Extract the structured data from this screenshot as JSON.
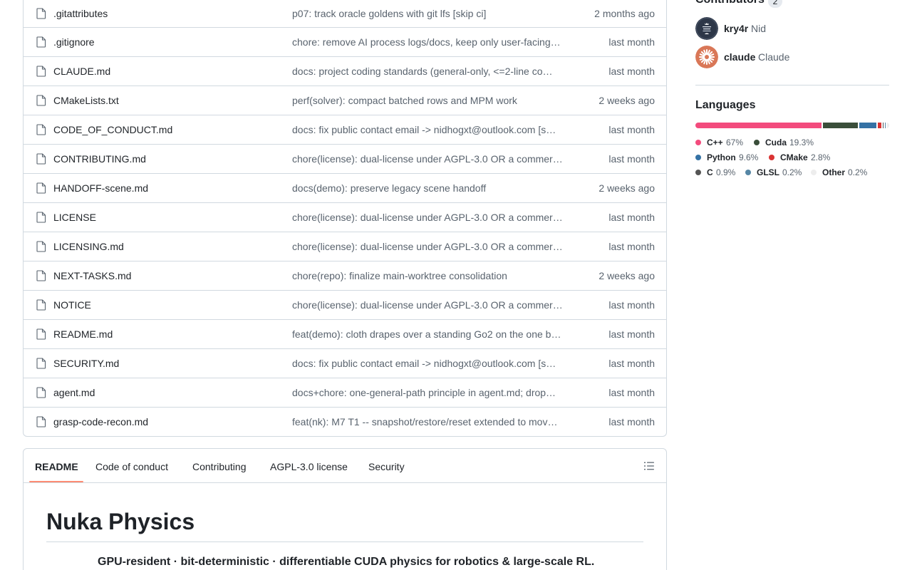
{
  "files": [
    {
      "name": ".gitattributes",
      "commit": "p07: track oracle goldens with git lfs [skip ci]",
      "date": "2 months ago"
    },
    {
      "name": ".gitignore",
      "commit": "chore: remove AI process logs/docs, keep only user-facing…",
      "date": "last month"
    },
    {
      "name": "CLAUDE.md",
      "commit": "docs: project coding standards (general-only, <=2-line co…",
      "date": "last month"
    },
    {
      "name": "CMakeLists.txt",
      "commit": "perf(solver): compact batched rows and MPM work",
      "date": "2 weeks ago"
    },
    {
      "name": "CODE_OF_CONDUCT.md",
      "commit": "docs: fix public contact email -> nidhogxt@outlook.com [s…",
      "date": "last month"
    },
    {
      "name": "CONTRIBUTING.md",
      "commit": "chore(license): dual-license under AGPL-3.0 OR a commer…",
      "date": "last month"
    },
    {
      "name": "HANDOFF-scene.md",
      "commit": "docs(demo): preserve legacy scene handoff",
      "date": "2 weeks ago"
    },
    {
      "name": "LICENSE",
      "commit": "chore(license): dual-license under AGPL-3.0 OR a commer…",
      "date": "last month"
    },
    {
      "name": "LICENSING.md",
      "commit": "chore(license): dual-license under AGPL-3.0 OR a commer…",
      "date": "last month"
    },
    {
      "name": "NEXT-TASKS.md",
      "commit": "chore(repo): finalize main-worktree consolidation",
      "date": "2 weeks ago"
    },
    {
      "name": "NOTICE",
      "commit": "chore(license): dual-license under AGPL-3.0 OR a commer…",
      "date": "last month"
    },
    {
      "name": "README.md",
      "commit": "feat(demo): cloth drapes over a standing Go2 on the one b…",
      "date": "last month"
    },
    {
      "name": "SECURITY.md",
      "commit": "docs: fix public contact email -> nidhogxt@outlook.com [s…",
      "date": "last month"
    },
    {
      "name": "agent.md",
      "commit": "docs+chore: one-general-path principle in agent.md; drop…",
      "date": "last month"
    },
    {
      "name": "grasp-code-recon.md",
      "commit": "feat(nk): M7 T1 -- snapshot/restore/reset extended to mov…",
      "date": "last month"
    }
  ],
  "readme": {
    "tabs": [
      "README",
      "Code of conduct",
      "Contributing",
      "AGPL-3.0 license",
      "Security"
    ],
    "active_tab": "README",
    "outline_icon": "list-unordered-icon",
    "title": "Nuka Physics",
    "tagline": "GPU-resident · bit-deterministic · differentiable CUDA physics for robotics & large-scale RL."
  },
  "sidebar": {
    "contributors_heading": "Contributors",
    "contributors_count": "2",
    "contributors": [
      {
        "login": "kry4r",
        "name": "Nid",
        "avatar_icon": "keep-calm-avatar-icon",
        "avatar_color": "#2d3748"
      },
      {
        "login": "claude",
        "name": "Claude",
        "avatar_icon": "claude-sunburst-avatar-icon",
        "avatar_color": "#d97757"
      }
    ],
    "languages_heading": "Languages",
    "languages": [
      {
        "name": "C++",
        "percent": "67%",
        "value": 67,
        "color": "#f34b7d"
      },
      {
        "name": "Cuda",
        "percent": "19.3%",
        "value": 19.3,
        "color": "#3a4e3a"
      },
      {
        "name": "Python",
        "percent": "9.6%",
        "value": 9.6,
        "color": "#3572a5"
      },
      {
        "name": "CMake",
        "percent": "2.8%",
        "value": 2.8,
        "color": "#da3434"
      },
      {
        "name": "C",
        "percent": "0.9%",
        "value": 0.9,
        "color": "#555555"
      },
      {
        "name": "GLSL",
        "percent": "0.2%",
        "value": 0.2,
        "color": "#5686a5"
      },
      {
        "name": "Other",
        "percent": "0.2%",
        "value": 0.2,
        "color": "#ededed"
      }
    ]
  }
}
